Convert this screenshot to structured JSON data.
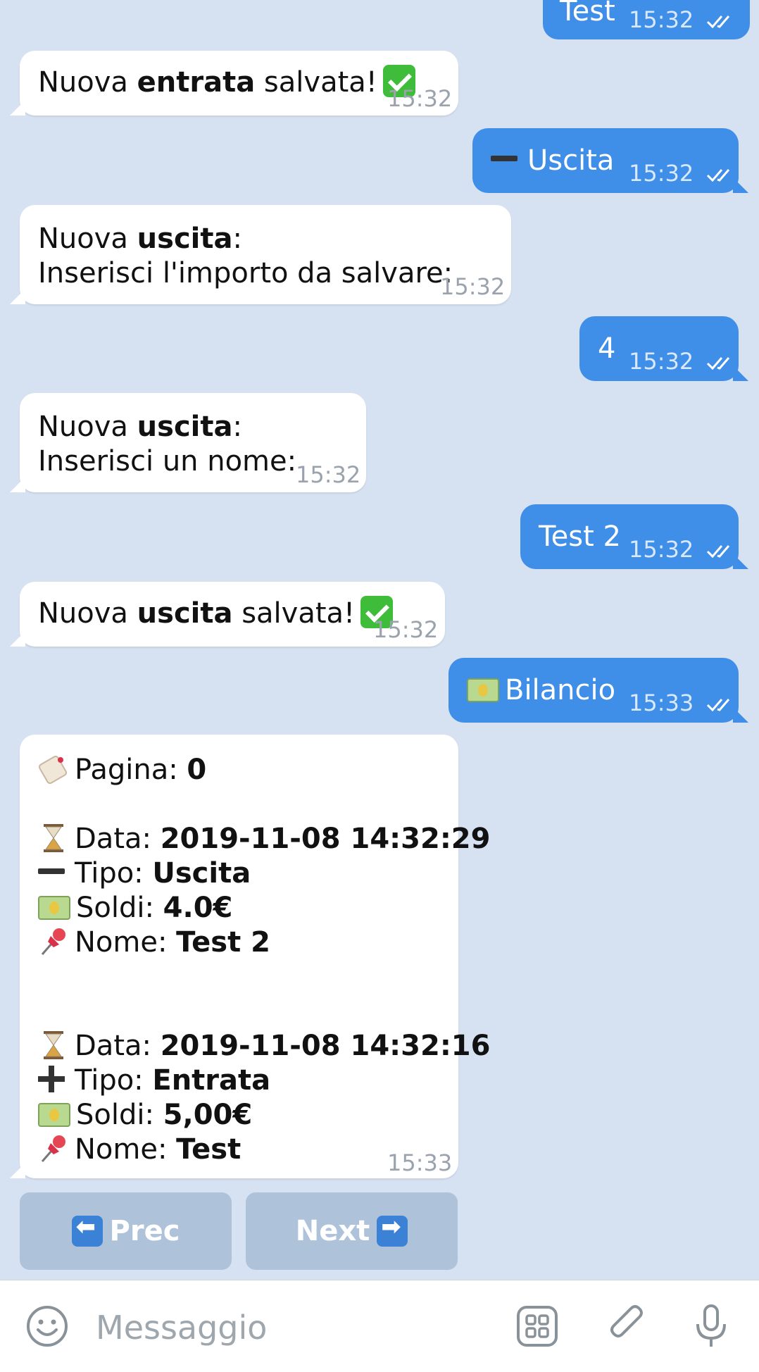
{
  "messages": {
    "m0": {
      "text": "Test",
      "time": "15:32"
    },
    "m1": {
      "pre": "Nuova ",
      "bold": "entrata",
      "post": " salvata!",
      "time": "15:32"
    },
    "m2": {
      "text": "Uscita",
      "time": "15:32"
    },
    "m3": {
      "line1_pre": "Nuova ",
      "line1_bold": "uscita",
      "line1_post": ":",
      "line2": "Inserisci l'importo da salvare:",
      "time": "15:32"
    },
    "m4": {
      "text": "4",
      "time": "15:32"
    },
    "m5": {
      "line1_pre": "Nuova ",
      "line1_bold": "uscita",
      "line1_post": ":",
      "line2": "Inserisci un nome:",
      "time": "15:32"
    },
    "m6": {
      "text": "Test 2",
      "time": "15:32"
    },
    "m7": {
      "pre": "Nuova ",
      "bold": "uscita",
      "post": " salvata!",
      "time": "15:32"
    },
    "m8": {
      "text": "Bilancio",
      "time": "15:33"
    },
    "m9": {
      "page_label": "Pagina: ",
      "page_value": "0",
      "entries": [
        {
          "date_label": "Data: ",
          "date": "2019-11-08 14:32:29",
          "type_label": "Tipo: ",
          "type": "Uscita",
          "money_label": "Soldi: ",
          "money": "4.0€",
          "name_label": "Nome: ",
          "name": "Test 2"
        },
        {
          "date_label": "Data: ",
          "date": "2019-11-08 14:32:16",
          "type_label": "Tipo: ",
          "type": "Entrata",
          "money_label": "Soldi: ",
          "money": "5,00€",
          "name_label": "Nome: ",
          "name": "Test"
        }
      ],
      "time": "15:33"
    }
  },
  "keyboard": {
    "prev": "Prec",
    "next": "Next"
  },
  "composer": {
    "placeholder": "Messaggio"
  },
  "colors": {
    "background": "#d6e2f2",
    "outgoing": "#3f8ee8",
    "incoming": "#ffffff",
    "inline_button": "#aec3d9"
  }
}
